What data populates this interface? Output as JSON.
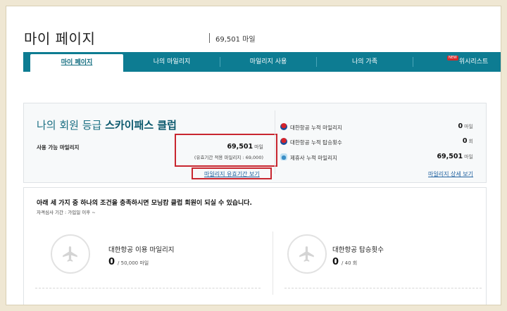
{
  "header": {
    "title": "마이 페이지",
    "points": "69,501 마일"
  },
  "tabs": [
    {
      "label": "마이 페이지",
      "active": true
    },
    {
      "label": "나의 마일리지"
    },
    {
      "label": "마일리지 사용"
    },
    {
      "label": "나의 가족"
    },
    {
      "label": "위시리스트",
      "badge": "NEW"
    }
  ],
  "grade": {
    "title_prefix": "나의 회원 등급",
    "title_grade": "스카이패스 클럽",
    "available_label": "사용 가능 마일리지",
    "available_value": "69,501",
    "available_unit": "마일",
    "expiry_note": "(유효기간 적용 마일리지 : 69,000)",
    "expiry_link": "마일리지 유효기간 보기"
  },
  "summary": {
    "rows": [
      {
        "label": "대한항공 누적 마일리지",
        "value": "0",
        "unit": "마일"
      },
      {
        "label": "대한항공 누적 탑승횟수",
        "value": "0",
        "unit": "회"
      },
      {
        "label": "제휴사 누적 마일리지",
        "value": "69,501",
        "unit": "마일"
      }
    ],
    "detail_link": "마일리지 상세 보기"
  },
  "conditions": {
    "title": "아래 세 가지 중 하나의 조건을 충족하시면 모닝캄 클럽 회원이 되실 수 있습니다.",
    "subtitle": "자격심사 기간 : 가입일 이후 ~",
    "items": [
      {
        "label": "대한항공 이용 마일리지",
        "value": "0",
        "target": "/ 50,000 마일",
        "progress": 0
      },
      {
        "label": "대한항공 탑승횟수",
        "value": "0",
        "target": "/ 40 회",
        "progress": 0
      }
    ]
  },
  "colors": {
    "tab_bar": "#0d7c92",
    "highlight_box": "#c8262f",
    "link": "#1d5f9e"
  }
}
